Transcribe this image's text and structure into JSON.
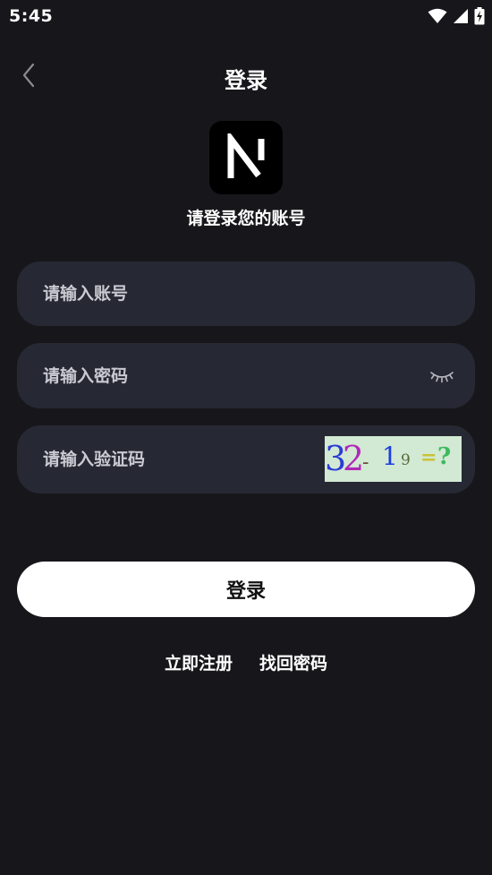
{
  "status_bar": {
    "time": "5:45",
    "icons": [
      "wifi-icon",
      "signal-icon",
      "battery-charging-icon"
    ]
  },
  "header": {
    "title": "登录",
    "back_icon": "chevron-left-icon"
  },
  "logo": {
    "letter": "N"
  },
  "subtitle": "请登录您的账号",
  "form": {
    "account": {
      "placeholder": "请输入账号",
      "value": ""
    },
    "password": {
      "placeholder": "请输入密码",
      "value": "",
      "toggle_icon": "eye-closed-icon"
    },
    "captcha": {
      "placeholder": "请输入验证码",
      "value": "",
      "image_text": [
        "3",
        "2",
        "-",
        "1",
        "9",
        "=",
        "?"
      ]
    }
  },
  "login_button": "登录",
  "links": {
    "register": "立即注册",
    "forgot_password": "找回密码"
  },
  "colors": {
    "background": "#17171b",
    "field_background": "#262833",
    "button_background": "#ffffff",
    "captcha_background": "#d2e9d3"
  }
}
